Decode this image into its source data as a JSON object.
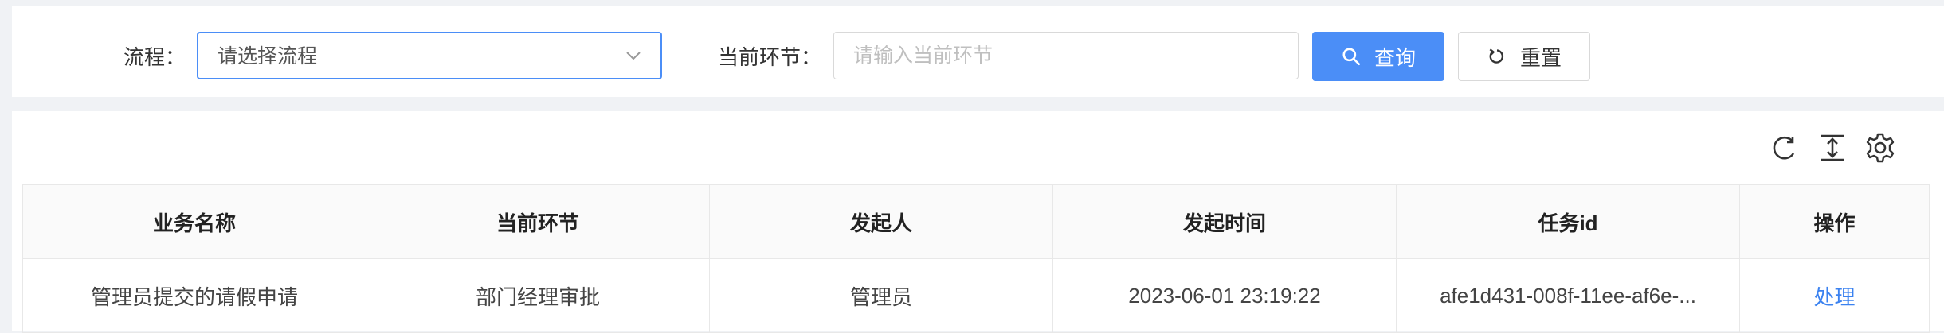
{
  "search": {
    "process_label": "流程：",
    "process_value": "请选择流程",
    "node_label": "当前环节：",
    "node_placeholder": "请输入当前环节",
    "query_label": "查询",
    "reset_label": "重置"
  },
  "table": {
    "columns": [
      "业务名称",
      "当前环节",
      "发起人",
      "发起时间",
      "任务id",
      "操作"
    ],
    "rows": [
      {
        "business_name": "管理员提交的请假申请",
        "current_node": "部门经理审批",
        "initiator": "管理员",
        "start_time": "2023-06-01 23:19:22",
        "task_id": "afe1d431-008f-11ee-af6e-...",
        "action": "处理"
      }
    ]
  },
  "colors": {
    "primary": "#4b8ef7",
    "link": "#3b82f0",
    "background": "#f0f2f5"
  },
  "icons": [
    "chevron-down-icon",
    "search-icon",
    "reset-icon",
    "refresh-icon",
    "column-height-icon",
    "settings-icon"
  ]
}
